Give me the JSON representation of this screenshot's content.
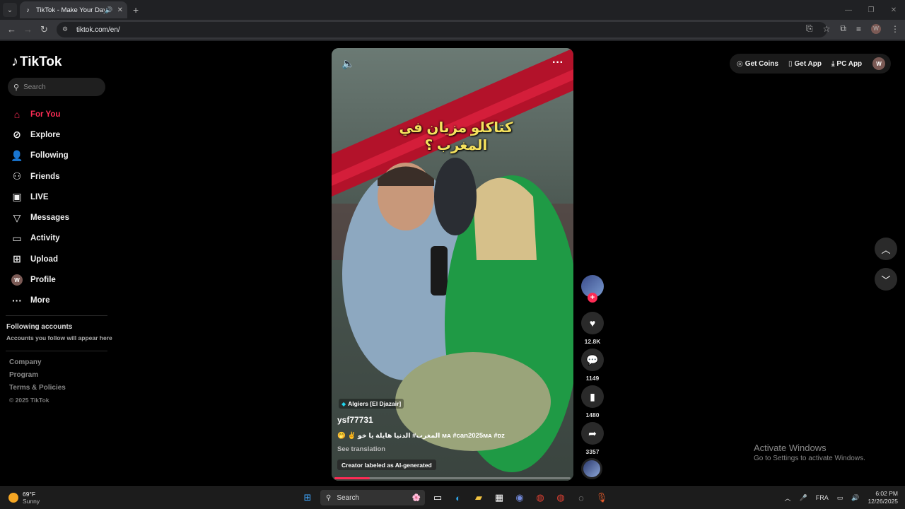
{
  "browser": {
    "tab_title": "TikTok - Make Your Day",
    "url": "tiktok.com/en/",
    "profile_initial": "W"
  },
  "sidebar": {
    "logo_text": "TikTok",
    "search_placeholder": "Search",
    "nav": [
      {
        "label": "For You",
        "icon": "home-icon"
      },
      {
        "label": "Explore",
        "icon": "compass-icon"
      },
      {
        "label": "Following",
        "icon": "user-follow-icon"
      },
      {
        "label": "Friends",
        "icon": "friends-icon"
      },
      {
        "label": "LIVE",
        "icon": "live-icon"
      },
      {
        "label": "Messages",
        "icon": "messages-icon"
      },
      {
        "label": "Activity",
        "icon": "activity-icon"
      },
      {
        "label": "Upload",
        "icon": "upload-icon"
      },
      {
        "label": "Profile",
        "icon": "profile-avatar"
      },
      {
        "label": "More",
        "icon": "more-icon"
      }
    ],
    "profile_initial": "W",
    "following_accounts_title": "Following accounts",
    "following_accounts_sub": "Accounts you follow will appear here",
    "footer": {
      "company": "Company",
      "program": "Program",
      "terms": "Terms & Policies",
      "copyright": "© 2025 TikTok"
    }
  },
  "video": {
    "overlay_text": "كتاكلو مزيان في المغرب ؟",
    "location": "Algiers [El Djazair]",
    "username": "ysf77731",
    "description": "🤭 ✌️ المغرب# الدنيا هايلة يا خو ᴍᴀ #can2025ᴍᴀ #ᴅᴢ",
    "see_translation": "See translation",
    "ai_label": "Creator labeled as AI-generated",
    "progress_percent": 15
  },
  "actions": {
    "likes": "12.8K",
    "comments": "1149",
    "bookmarks": "1480",
    "shares": "3357"
  },
  "topbar": {
    "get_coins": "Get Coins",
    "get_app": "Get App",
    "pc_app": "PC App",
    "user_initial": "W"
  },
  "watermark": {
    "line1": "Activate Windows",
    "line2": "Go to Settings to activate Windows."
  },
  "taskbar": {
    "temp": "69°F",
    "weather": "Sunny",
    "search": "Search",
    "lang": "FRA",
    "time": "6:02 PM",
    "date": "12/26/2025"
  },
  "colors": {
    "accent": "#fe2c55",
    "background": "#000000"
  }
}
